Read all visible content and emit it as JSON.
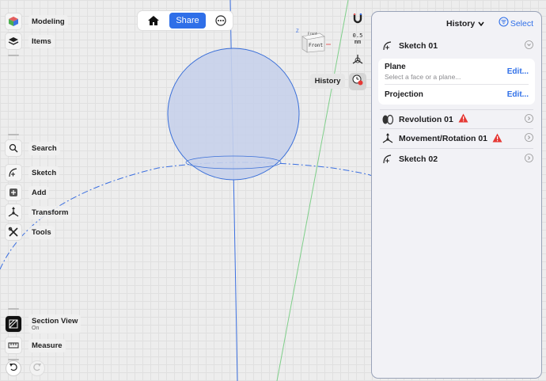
{
  "left_toolbar": {
    "top": [
      {
        "label": "Modeling",
        "icon": "cube-icon"
      },
      {
        "label": "Items",
        "icon": "layers-icon"
      }
    ],
    "middle": [
      {
        "label": "Search",
        "icon": "search-icon"
      },
      {
        "label": "Sketch",
        "icon": "sketch-icon"
      },
      {
        "label": "Add",
        "icon": "plus-icon"
      },
      {
        "label": "Transform",
        "icon": "transform-icon"
      },
      {
        "label": "Tools",
        "icon": "tools-icon"
      }
    ],
    "bottom": [
      {
        "label": "Section View",
        "sub": "On",
        "icon": "section-view-icon"
      },
      {
        "label": "Measure",
        "icon": "ruler-icon"
      }
    ]
  },
  "topbar": {
    "share_label": "Share"
  },
  "mini_tools": {
    "grid_value": "0.5",
    "grid_unit": "mm"
  },
  "view_cube": {
    "front_label": "Front",
    "top_label": "Front"
  },
  "history_tag": "History",
  "panel": {
    "title": "History",
    "select_label": "Select",
    "items": [
      {
        "label": "Sketch 01",
        "icon": "sketch-icon",
        "warning": false,
        "expanded": true
      },
      {
        "label": "Revolution 01",
        "icon": "revolution-icon",
        "warning": true
      },
      {
        "label": "Movement/Rotation 01",
        "icon": "transform-icon",
        "warning": true
      },
      {
        "label": "Sketch 02",
        "icon": "sketch-icon",
        "warning": false
      }
    ],
    "sketch_details": {
      "plane_label": "Plane",
      "plane_placeholder": "Select a face or a plane...",
      "plane_edit": "Edit...",
      "projection_label": "Projection",
      "projection_edit": "Edit..."
    }
  },
  "colors": {
    "accent": "#2f6fe8",
    "warning": "#e53935",
    "sphere_fill": "#c7d0ea",
    "sphere_stroke": "#3a6fd8"
  }
}
